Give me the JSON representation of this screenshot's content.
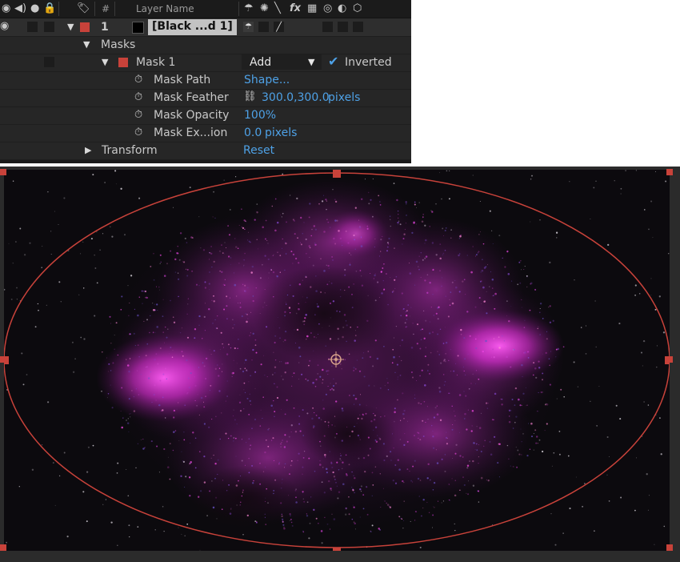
{
  "header": {
    "col_num": "#",
    "col_layer_name": "Layer Name",
    "icons": [
      "eye-icon",
      "audio-icon",
      "solo-icon",
      "lock-icon",
      "label-icon",
      "shy-icon",
      "collapse-icon",
      "quality-icon",
      "effects-icon",
      "frame-blend-icon",
      "motion-blur-icon",
      "adjustment-icon",
      "3d-layer-icon"
    ]
  },
  "layer": {
    "number": "1",
    "name": "[Black ...d 1]",
    "label_color": "#c8423a"
  },
  "masks_group": {
    "label": "Masks"
  },
  "mask1": {
    "label": "Mask 1",
    "mode": "Add",
    "inverted_label": "Inverted",
    "inverted_checked": true,
    "color": "#c8423a"
  },
  "props": [
    {
      "name": "Mask Path",
      "value": "Shape...",
      "unit": ""
    },
    {
      "name": "Mask Feather",
      "value": "300.0,300.0",
      "unit": "pixels"
    },
    {
      "name": "Mask Opacity",
      "value": "100%",
      "unit": ""
    },
    {
      "name": "Mask Ex...ion",
      "value": "0.0",
      "unit": "pixels"
    }
  ],
  "transform": {
    "label": "Transform",
    "reset_label": "Reset"
  },
  "viewer": {
    "mask_color": "#c8423a",
    "nebula_color": "#ff3df0",
    "background_color": "#0c0a0e"
  }
}
